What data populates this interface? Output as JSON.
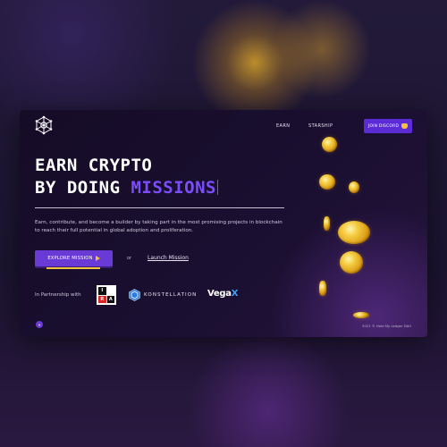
{
  "nav": {
    "earn": "EARN",
    "starship": "STARSHIP",
    "join_discord": "JOIN DISCORD"
  },
  "hero": {
    "line1": "EARN CRYPTO",
    "line2_prefix": "BY DOING",
    "line2_accent": "MISSIONS",
    "subtitle": "Earn, contribute, and become a builder by taking part in the most promising projects in blockchain to reach their full potential in global adoption and proliferation."
  },
  "cta": {
    "explore": "EXPLORE MISSION",
    "or": "or",
    "launch": "Launch Mission"
  },
  "partners": {
    "label": "In Partnership with",
    "ira_letters": [
      "I",
      "",
      "R",
      "A"
    ],
    "konstellation": "KONSTELLATION",
    "vega": "Vega",
    "vega_x": "X"
  },
  "footer": {
    "copyright": "2021 © Hold My Ledger DAO"
  },
  "icons": {
    "logo": "hexagon-network-logo",
    "discord": "discord-icon",
    "play": "play-icon",
    "twitter": "twitter-icon"
  },
  "colors": {
    "accent": "#7b4dff",
    "button": "#6a3ad6",
    "gold": "#f3c23f",
    "card_bg": "#150c27"
  }
}
